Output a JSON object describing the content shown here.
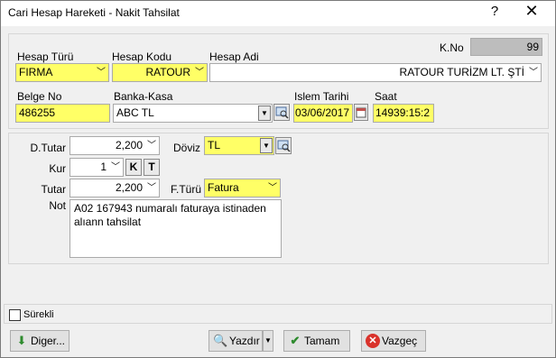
{
  "window": {
    "title": "Cari Hesap Hareketi - Nakit Tahsilat",
    "help": "?",
    "close": "✕"
  },
  "top": {
    "hesap_turu_label": "Hesap Türü",
    "hesap_turu_value": "FIRMA",
    "hesap_kodu_label": "Hesap Kodu",
    "hesap_kodu_value": "RATOUR",
    "hesap_adi_label": "Hesap Adi",
    "hesap_adi_value": "RATOUR TURİZM LT. ŞTİ",
    "kno_label": "K.No",
    "kno_value": "99",
    "belge_no_label": "Belge No",
    "belge_no_value": "486255",
    "banka_kasa_label": "Banka-Kasa",
    "banka_kasa_value": "ABC TL",
    "islem_tarihi_label": "Islem Tarihi",
    "islem_tarihi_value": "03/06/2017",
    "saat_label": "Saat",
    "saat_value": "14939:15:2"
  },
  "mid": {
    "dtutar_label": "D.Tutar",
    "dtutar_value": "2,200",
    "doviz_label": "Döviz",
    "doviz_value": "TL",
    "kur_label": "Kur",
    "kur_value": "1",
    "k_btn": "K",
    "t_btn": "T",
    "tutar_label": "Tutar",
    "tutar_value": "2,200",
    "fturu_label": "F.Türü",
    "fturu_value": "Fatura",
    "not_label": "Not",
    "not_value": "A02 167943 numaralı faturaya istinaden\nalıann tahsilat"
  },
  "bottom": {
    "surekli_label": "Sürekli"
  },
  "buttons": {
    "diger": "Diger...",
    "yazdir": "Yazdır",
    "tamam": "Tamam",
    "vazgec": "Vazgeç"
  },
  "colors": {
    "yellow_field": "#ffff66",
    "kno_field": "#bdbdbd"
  }
}
